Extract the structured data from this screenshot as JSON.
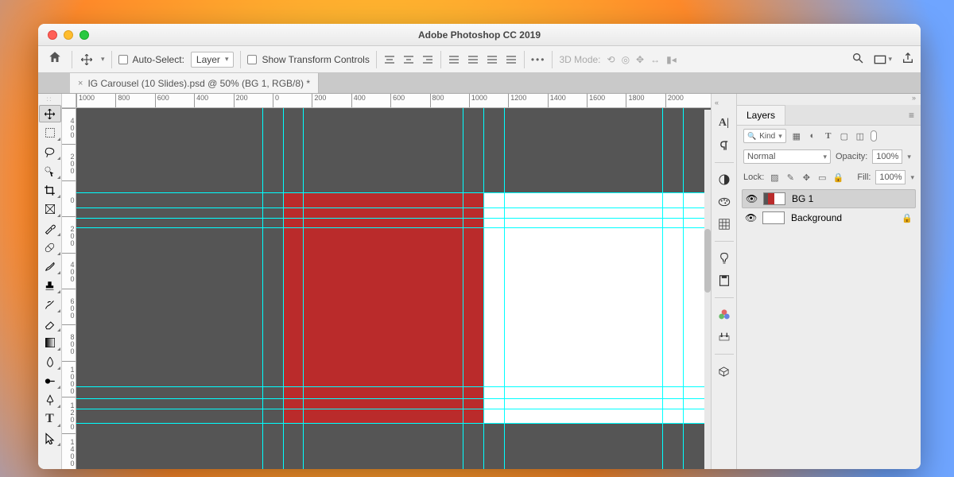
{
  "window": {
    "title": "Adobe Photoshop CC 2019"
  },
  "tab": {
    "close_glyph": "×",
    "label": "IG Carousel (10 Slides).psd @ 50% (BG 1, RGB/8) *"
  },
  "options": {
    "auto_select": "Auto-Select:",
    "layer_dd": "Layer",
    "show_transform": "Show Transform Controls",
    "more": "•••",
    "mode3d": "3D Mode:"
  },
  "ruler_h": [
    "1000",
    "800",
    "600",
    "400",
    "200",
    "0",
    "200",
    "400",
    "600",
    "800",
    "1000",
    "1200",
    "1400",
    "1600",
    "1800",
    "2000"
  ],
  "ruler_v": [
    "400",
    "200",
    "0",
    "200",
    "400",
    "600",
    "800",
    "1000",
    "1200",
    "1400"
  ],
  "layers_panel": {
    "tab": "Layers",
    "kind": "Kind",
    "blend": "Normal",
    "opacity_label": "Opacity:",
    "opacity_value": "100%",
    "lock_label": "Lock:",
    "fill_label": "Fill:",
    "fill_value": "100%",
    "items": [
      {
        "name": "BG 1",
        "selected": true,
        "thumb": "red",
        "locked": false
      },
      {
        "name": "Background",
        "selected": false,
        "thumb": "white",
        "locked": true
      }
    ]
  },
  "icons": {
    "home": "⌂",
    "move": "✥",
    "chev": "▾",
    "search": "🔍",
    "screen": "▭",
    "share": "⇪",
    "align": [
      "≡",
      "≣",
      "≡",
      "≣",
      "≡",
      "≣",
      "≡",
      "≣"
    ]
  }
}
